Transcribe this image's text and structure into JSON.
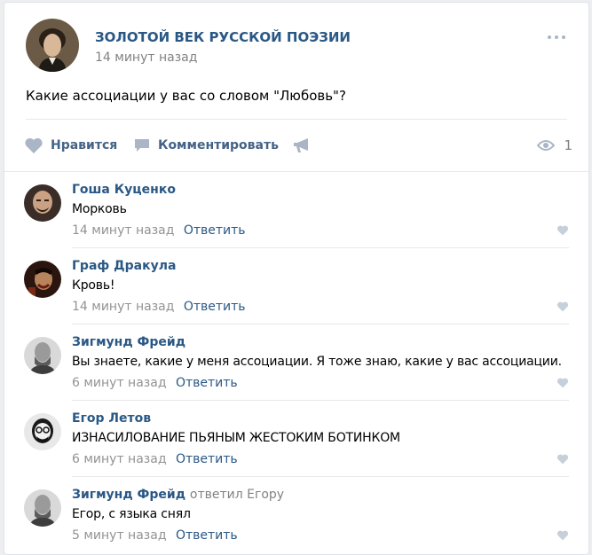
{
  "post": {
    "group_name": "ЗОЛОТОЙ ВЕК РУССКОЙ ПОЭЗИИ",
    "time": "14 минут назад",
    "text": "Какие ассоциации у вас со словом \"Любовь\"?",
    "more_icon": "more-horizontal-icon"
  },
  "actions": {
    "like_label": "Нравится",
    "comment_label": "Комментировать",
    "share_icon": "megaphone-icon",
    "views_icon": "eye-icon",
    "views_count": "1"
  },
  "comments": [
    {
      "author": "Гоша Куценко",
      "reply_to": "",
      "text": "Морковь",
      "time": "14 минут назад",
      "reply_label": "Ответить"
    },
    {
      "author": "Граф Дракула",
      "reply_to": "",
      "text": "Кровь!",
      "time": "14 минут назад",
      "reply_label": "Ответить"
    },
    {
      "author": "Зигмунд Фрейд",
      "reply_to": "",
      "text": "Вы знаете, какие у меня ассоциации. Я тоже знаю, какие у вас ассоциации.",
      "time": "6 минут назад",
      "reply_label": "Ответить"
    },
    {
      "author": "Егор Летов",
      "reply_to": "",
      "text": "ИЗНАСИЛОВАНИЕ ПЬЯНЫМ ЖЕСТОКИМ БОТИНКОМ",
      "time": "6 минут назад",
      "reply_label": "Ответить"
    },
    {
      "author": "Зигмунд Фрейд",
      "reply_to": "ответил Егору",
      "text": "Егор, с языка снял",
      "time": "5 минут назад",
      "reply_label": "Ответить"
    }
  ],
  "colors": {
    "link": "#2a5885",
    "action": "#456387",
    "muted": "#828282",
    "icon": "#aab6c5",
    "background": "#edeef0"
  }
}
